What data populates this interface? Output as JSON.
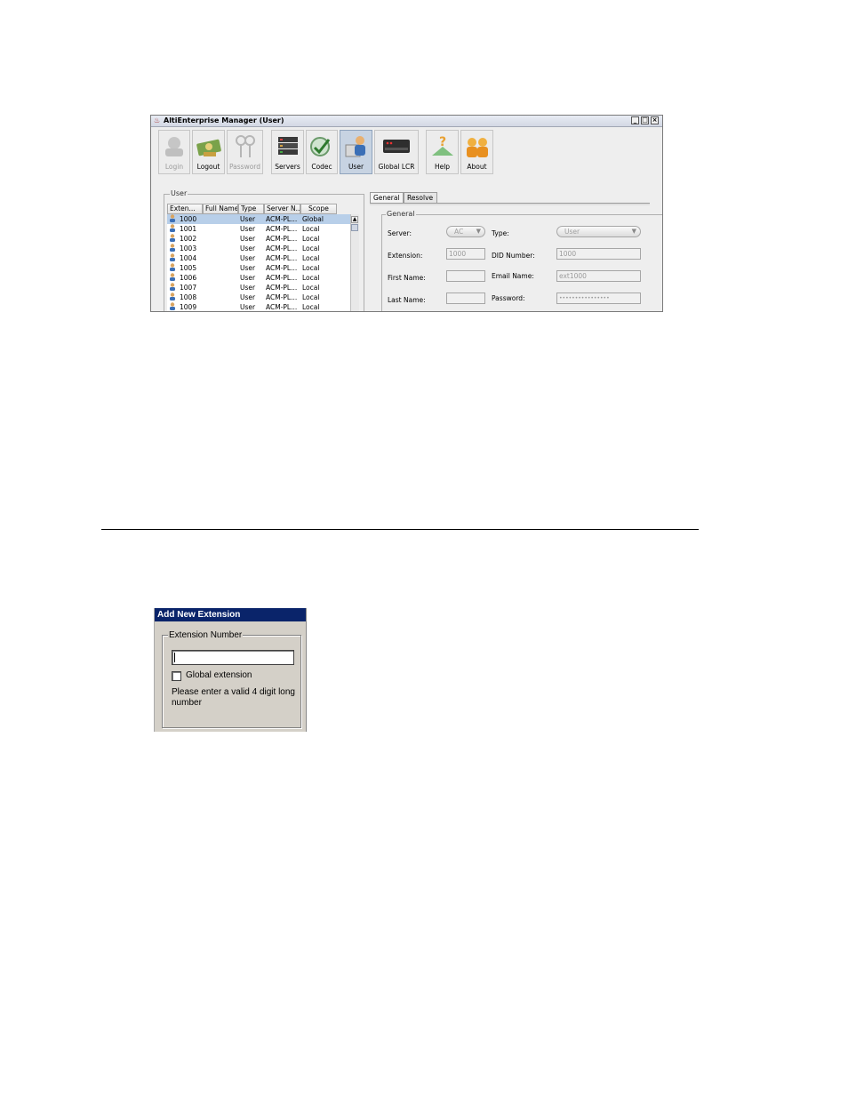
{
  "window": {
    "title": "AltiEnterprise Manager  (User)",
    "controls": [
      "_",
      "□",
      "×"
    ]
  },
  "toolbar": {
    "buttons": [
      {
        "label": "Login",
        "icon": "login-icon",
        "disabled": true
      },
      {
        "label": "Logout",
        "icon": "logout-icon",
        "disabled": false
      },
      {
        "label": "Password",
        "icon": "password-keys-icon",
        "disabled": true
      },
      {
        "label": "Servers",
        "icon": "servers-icon",
        "disabled": false
      },
      {
        "label": "Codec",
        "icon": "codec-icon",
        "disabled": false
      },
      {
        "label": "User",
        "icon": "user-icon",
        "disabled": false,
        "active": true
      },
      {
        "label": "Global LCR",
        "icon": "global-lcr-icon",
        "disabled": false
      },
      {
        "label": "Help",
        "icon": "help-icon",
        "disabled": false
      },
      {
        "label": "About",
        "icon": "about-icon",
        "disabled": false
      }
    ]
  },
  "user_panel": {
    "legend": "User",
    "columns": [
      "Exten...",
      "Full Name",
      "Type",
      "Server N...",
      "Scope"
    ],
    "rows": [
      {
        "ext": "1000",
        "full_name": "",
        "type": "User",
        "server": "ACM-PL...",
        "scope": "Global",
        "selected": true
      },
      {
        "ext": "1001",
        "full_name": "",
        "type": "User",
        "server": "ACM-PL...",
        "scope": "Local"
      },
      {
        "ext": "1002",
        "full_name": "",
        "type": "User",
        "server": "ACM-PL...",
        "scope": "Local"
      },
      {
        "ext": "1003",
        "full_name": "",
        "type": "User",
        "server": "ACM-PL...",
        "scope": "Local"
      },
      {
        "ext": "1004",
        "full_name": "",
        "type": "User",
        "server": "ACM-PL...",
        "scope": "Local"
      },
      {
        "ext": "1005",
        "full_name": "",
        "type": "User",
        "server": "ACM-PL...",
        "scope": "Local"
      },
      {
        "ext": "1006",
        "full_name": "",
        "type": "User",
        "server": "ACM-PL...",
        "scope": "Local"
      },
      {
        "ext": "1007",
        "full_name": "",
        "type": "User",
        "server": "ACM-PL...",
        "scope": "Local"
      },
      {
        "ext": "1008",
        "full_name": "",
        "type": "User",
        "server": "ACM-PL...",
        "scope": "Local"
      },
      {
        "ext": "1009",
        "full_name": "",
        "type": "User",
        "server": "ACM-PL...",
        "scope": "Local"
      }
    ]
  },
  "tabs": [
    "General",
    "Resolve"
  ],
  "general": {
    "legend": "General",
    "server_label": "Server:",
    "server_value": "AC",
    "type_label": "Type:",
    "type_value": "User",
    "extension_label": "Extension:",
    "extension_value": "1000",
    "did_label": "DID Number:",
    "did_value": "1000",
    "first_name_label": "First Name:",
    "first_name_value": "",
    "email_label": "Email Name:",
    "email_value": "ext1000",
    "last_name_label": "Last Name:",
    "last_name_value": "",
    "password_label": "Password:",
    "password_value": "••••••••••••••••"
  },
  "dialog": {
    "title": "Add New Extension",
    "group_legend": "Extension Number",
    "input_value": "",
    "checkbox_label": "Global extension",
    "checkbox_checked": false,
    "hint": "Please enter a valid 4 digit long number"
  }
}
